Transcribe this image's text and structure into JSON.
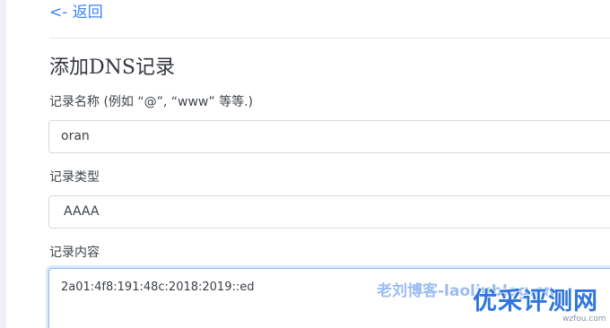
{
  "nav": {
    "back_label": "<- 返回"
  },
  "form": {
    "title": "添加DNS记录",
    "record_name": {
      "label": "记录名称 (例如 “@”, “www” 等等.)",
      "value": "oran"
    },
    "record_type": {
      "label": "记录类型",
      "value": "AAAA"
    },
    "record_content": {
      "label": "记录内容",
      "value": "2a01:4f8:191:48c:2018:2019::ed"
    }
  },
  "watermarks": {
    "blog": "老刘博客-laoliublog.cn",
    "site": "优采评测网",
    "domain": "wzfou.com"
  },
  "colors": {
    "link": "#3b82f6",
    "focus_border": "#8fb8ee",
    "watermark": "#2f76dc"
  }
}
